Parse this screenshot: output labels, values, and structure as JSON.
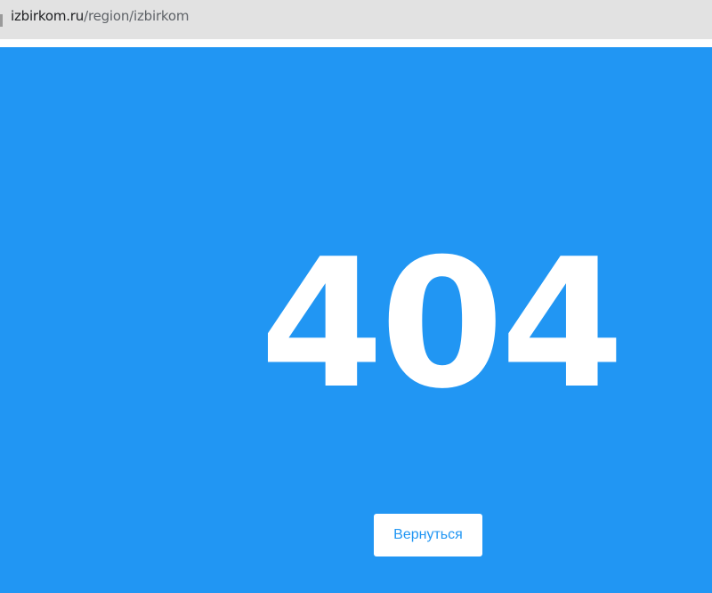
{
  "browser": {
    "url_host": "izbirkom.ru",
    "url_path": "/region/izbirkom"
  },
  "page": {
    "error_code": "404",
    "back_button_label": "Вернуться"
  },
  "colors": {
    "page_background": "#2196f3",
    "address_bar_background": "#e2e2e2",
    "button_background": "#ffffff",
    "button_text": "#2196f3"
  }
}
